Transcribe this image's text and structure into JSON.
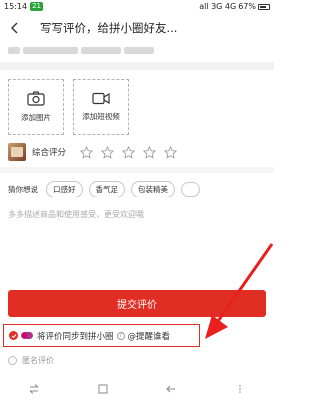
{
  "status_bar": {
    "time": "15:14",
    "notification_badge": "21",
    "network": "all 3G 4G",
    "battery": "67%"
  },
  "header": {
    "title": "写写评价，给拼小圈好友..."
  },
  "upload": {
    "add_photo_label": "添加图片",
    "add_video_label": "添加短视频"
  },
  "rating": {
    "label": "综合评分",
    "stars": 5
  },
  "tags": {
    "label": "猜你想说",
    "items": [
      "口感好",
      "香气足",
      "包装精美"
    ]
  },
  "description": {
    "placeholder": "多多描述商品和使用感受，更受欢迎哦"
  },
  "submit": {
    "label": "提交评价"
  },
  "sync": {
    "text": "将评价同步到拼小圈",
    "remind_label": "@提醒谁看"
  },
  "anonymous": {
    "label": "匿名评价"
  },
  "colors": {
    "accent": "#e02e24",
    "annotation": "#e8201e"
  }
}
